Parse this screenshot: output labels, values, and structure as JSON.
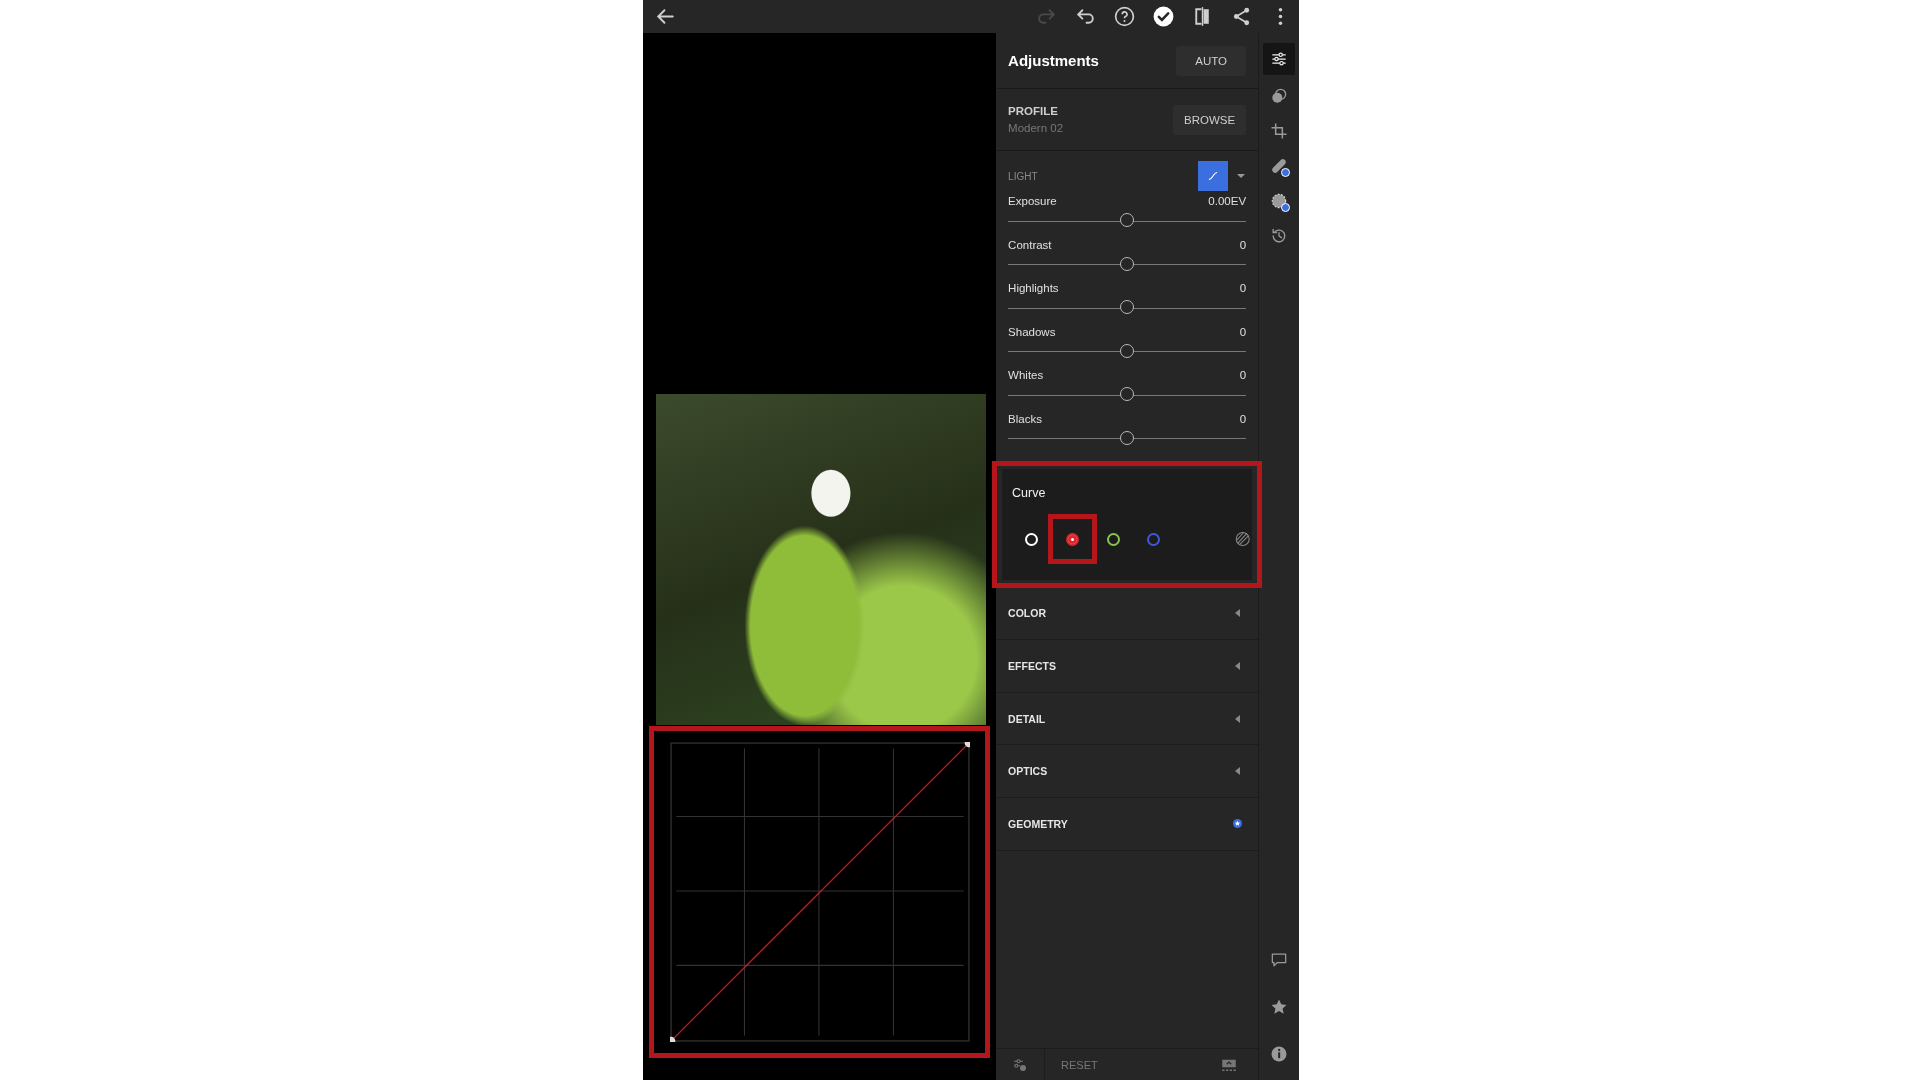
{
  "toolbar": [
    {
      "kind": "back",
      "disabled": false
    },
    {
      "kind": "redo",
      "disabled": true
    },
    {
      "kind": "undo",
      "disabled": false
    },
    {
      "kind": "help",
      "disabled": false
    },
    {
      "kind": "done",
      "disabled": false
    },
    {
      "kind": "compare",
      "disabled": false
    },
    {
      "kind": "share",
      "disabled": false
    },
    {
      "kind": "more",
      "disabled": false
    }
  ],
  "panel": {
    "title": "Adjustments",
    "auto_button": "AUTO",
    "profile": {
      "label": "PROFILE",
      "value": "Modern 02",
      "button": "BROWSE"
    },
    "light": {
      "label": "LIGHT",
      "curve_on": true,
      "sliders": [
        {
          "name": "Exposure",
          "value": "0.00EV",
          "level": 0.5
        },
        {
          "name": "Contrast",
          "value": "0",
          "level": 0.5
        },
        {
          "name": "Highlights",
          "value": "0",
          "level": 0.5
        },
        {
          "name": "Shadows",
          "value": "0",
          "level": 0.5
        },
        {
          "name": "Whites",
          "value": "0",
          "level": 0.5
        },
        {
          "name": "Blacks",
          "value": "0",
          "level": 0.5
        }
      ]
    },
    "curve": {
      "title": "Curve",
      "channels": [
        {
          "color": "#ffffff",
          "selected": false
        },
        {
          "color": "#e0262d",
          "selected": true
        },
        {
          "color": "#8bc34a",
          "selected": false
        },
        {
          "color": "#3f5ad8",
          "selected": false
        }
      ]
    },
    "sections": [
      {
        "label": "COLOR",
        "kind": "collapsed"
      },
      {
        "label": "EFFECTS",
        "kind": "collapsed"
      },
      {
        "label": "DETAIL",
        "kind": "collapsed"
      },
      {
        "label": "OPTICS",
        "kind": "collapsed"
      },
      {
        "label": "GEOMETRY",
        "kind": "modified"
      }
    ],
    "footer": {
      "reset": "RESET"
    }
  },
  "tool_rail": [
    {
      "kind": "adjust",
      "selected": true,
      "badge": false
    },
    {
      "kind": "presets",
      "selected": false,
      "badge": false
    },
    {
      "kind": "crop",
      "selected": false,
      "badge": false
    },
    {
      "kind": "heal",
      "selected": false,
      "badge": true
    },
    {
      "kind": "mask",
      "selected": false,
      "badge": true
    },
    {
      "kind": "history",
      "selected": false,
      "badge": false
    }
  ],
  "rail_bottom": [
    {
      "kind": "comment"
    },
    {
      "kind": "rating"
    },
    {
      "kind": "info"
    }
  ]
}
